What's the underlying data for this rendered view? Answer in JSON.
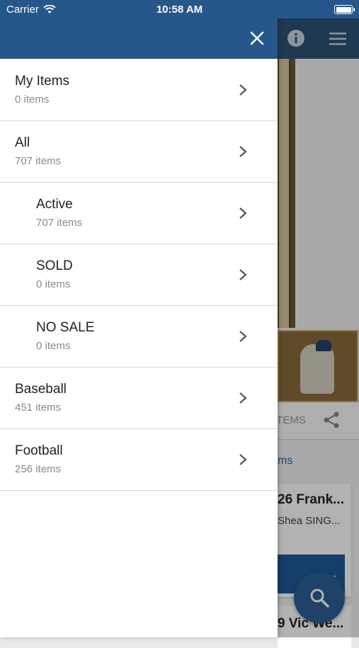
{
  "status_bar": {
    "carrier": "Carrier",
    "time": "10:58 AM"
  },
  "background": {
    "tab_label": "ITEMS",
    "link_text": "ms",
    "card1_title": "26 Frank...",
    "card1_subtitle": "Shea SING...",
    "card2_title": "9 Vic We..."
  },
  "drawer": {
    "items": [
      {
        "label": "My Items",
        "count": "0 items"
      },
      {
        "label": "All",
        "count": "707 items"
      },
      {
        "label": "Active",
        "count": "707 items"
      },
      {
        "label": "SOLD",
        "count": "0 items"
      },
      {
        "label": "NO SALE",
        "count": "0 items"
      },
      {
        "label": "Baseball",
        "count": "451 items"
      },
      {
        "label": "Football",
        "count": "256 items"
      }
    ]
  },
  "colors": {
    "header": "#26578a",
    "accent": "#2b5f95"
  },
  "icons": [
    "wifi-icon",
    "battery-icon",
    "close-icon",
    "chevron-right-icon",
    "info-icon",
    "menu-icon",
    "share-icon",
    "search-icon"
  ]
}
